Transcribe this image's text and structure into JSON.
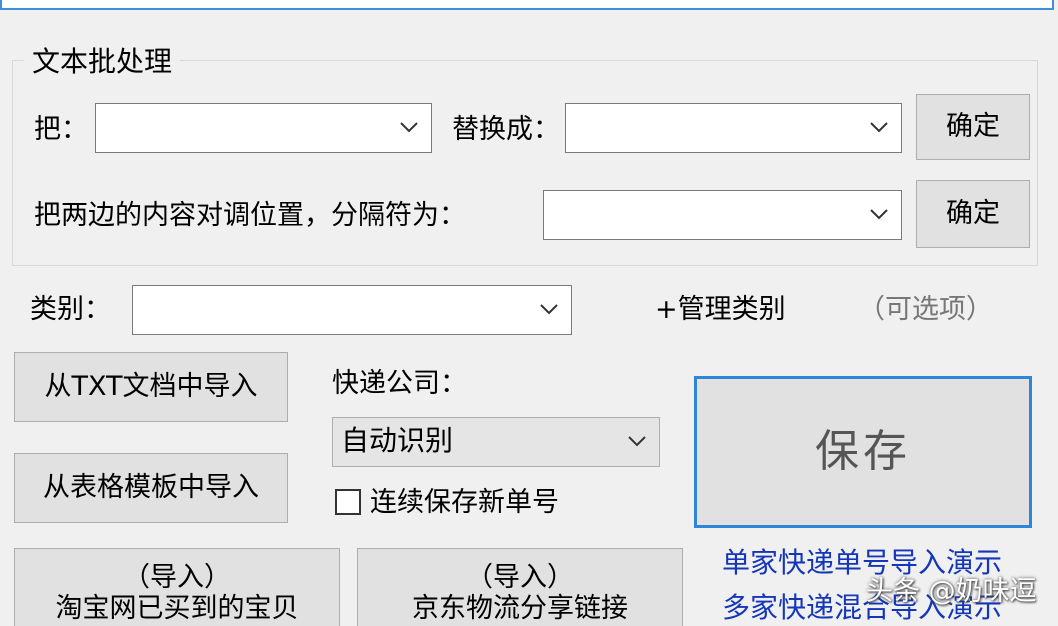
{
  "batch": {
    "title": "文本批处理",
    "from_label": "把：",
    "from_value": "",
    "replace_label": "替换成：",
    "replace_value": "",
    "confirm_label": "确定",
    "swap_label": "把两边的内容对调位置，分隔符为：",
    "swap_value": "",
    "confirm2_label": "确定"
  },
  "category": {
    "label": "类别：",
    "value": "",
    "manage_label": "+管理类别",
    "optional_hint": "（可选项）"
  },
  "import": {
    "txt_label": "从TXT文档中导入",
    "sheet_label": "从表格模板中导入",
    "taobao_top": "（导入）",
    "taobao_bottom": "淘宝网已买到的宝贝",
    "jd_top": "（导入）",
    "jd_bottom": "京东物流分享链接"
  },
  "courier": {
    "label": "快递公司：",
    "value": "自动识别"
  },
  "continuous_save": {
    "label": "连续保存新单号",
    "checked": false
  },
  "save_label": "保存",
  "links": {
    "single": "单家快递单号导入演示",
    "multi": "多家快递混合导入演示"
  },
  "watermark": "头条 @奶味逗"
}
